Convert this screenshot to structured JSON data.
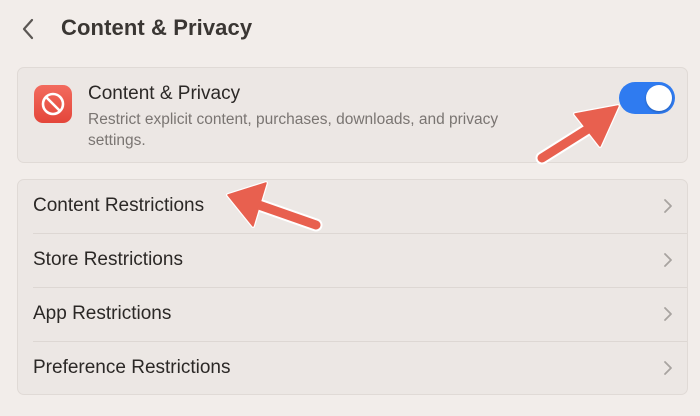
{
  "header": {
    "title": "Content & Privacy",
    "back_icon": "chevron-left-icon"
  },
  "content_privacy": {
    "title": "Content & Privacy",
    "description": "Restrict explicit content, purchases, downloads, and privacy settings.",
    "icon": "prohibited-icon",
    "icon_color": "#e9514a",
    "toggle_on": true,
    "toggle_color": "#2f7bf0"
  },
  "restrictions": [
    {
      "label": "Content Restrictions"
    },
    {
      "label": "Store Restrictions"
    },
    {
      "label": "App Restrictions"
    },
    {
      "label": "Preference Restrictions"
    }
  ],
  "annotation_arrow_color": "#e8604f"
}
